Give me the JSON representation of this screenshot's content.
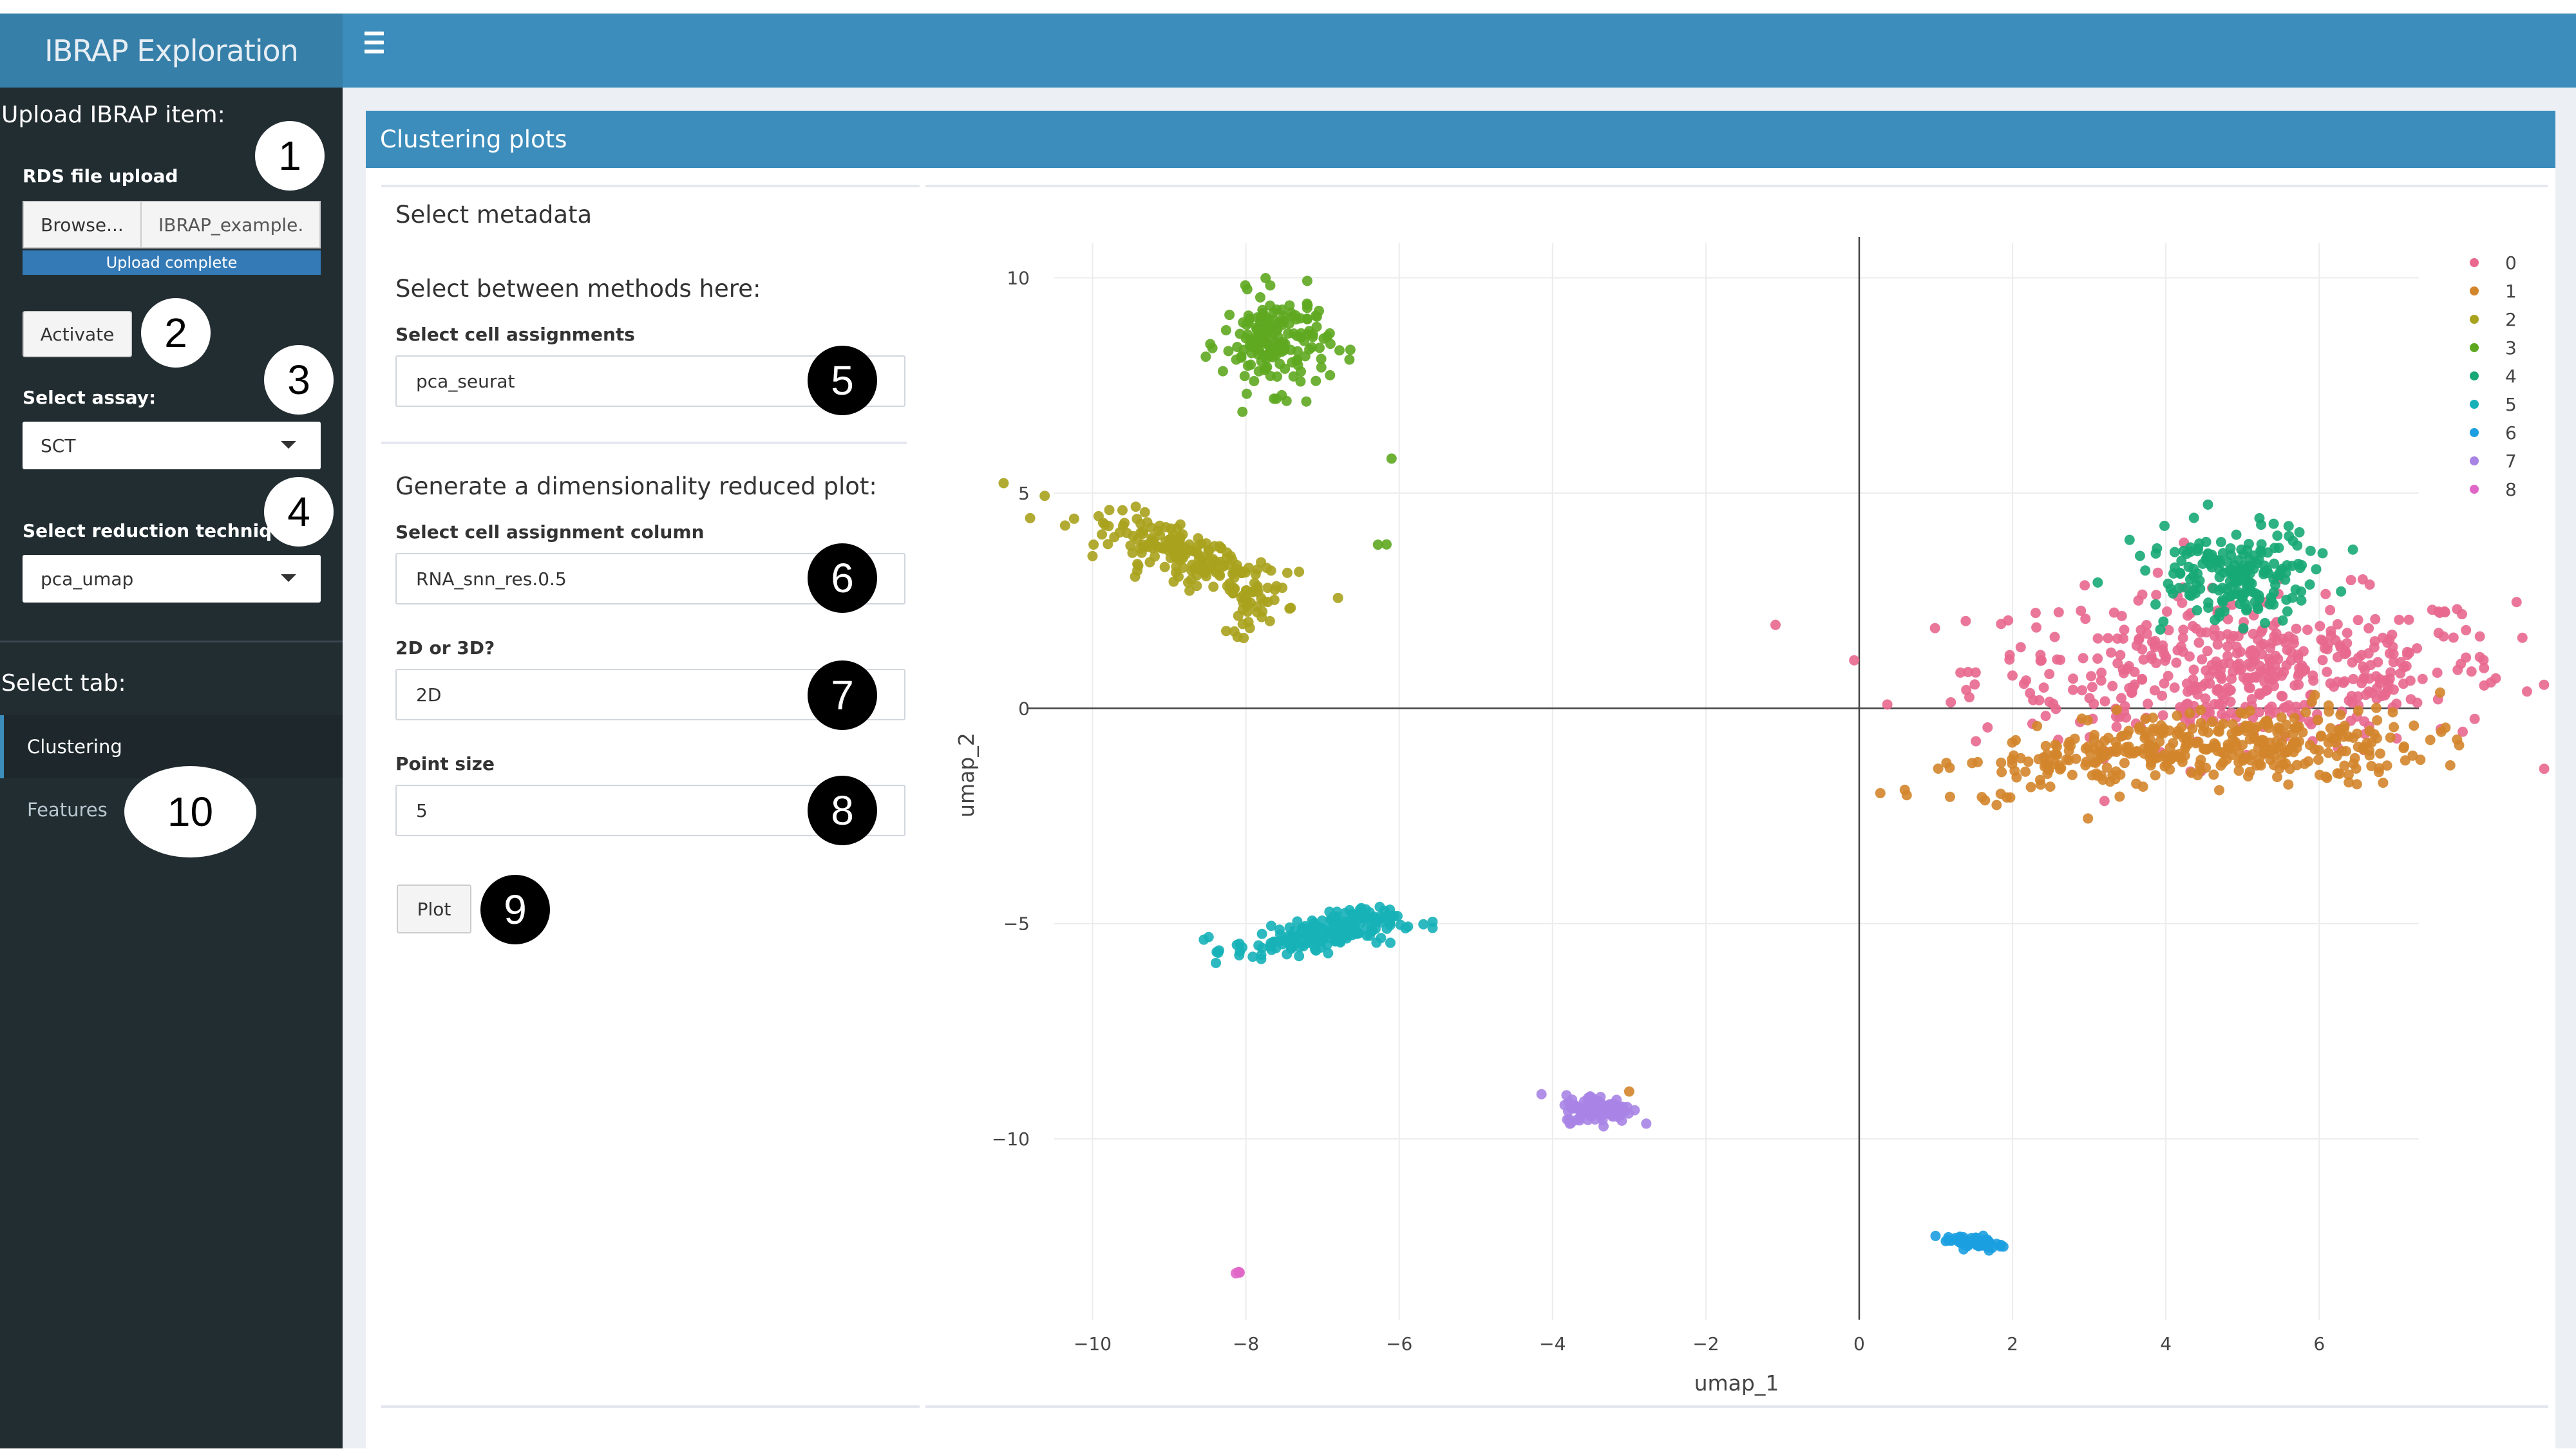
{
  "app": {
    "title": "IBRAP Exploration"
  },
  "sidebar": {
    "upload_title": "Upload IBRAP item:",
    "rds_label": "RDS file upload",
    "browse_label": "Browse...",
    "file_name": "IBRAP_example.",
    "upload_status": "Upload complete",
    "activate_label": "Activate",
    "assay_label": "Select assay:",
    "assay_value": "SCT",
    "reduction_label": "Select reduction technique",
    "reduction_value": "pca_umap",
    "tab_title": "Select tab:",
    "tabs": [
      {
        "label": "Clustering",
        "active": true
      },
      {
        "label": "Features",
        "active": false
      }
    ]
  },
  "main": {
    "box_title": "Clustering plots",
    "section_title": "Select metadata",
    "methods_heading": "Select between methods here:",
    "cell_assign_label": "Select cell assignments",
    "cell_assign_value": "pca_seurat",
    "dimred_heading": "Generate a dimensionality reduced plot:",
    "column_label": "Select cell assignment column",
    "column_value": "RNA_snn_res.0.5",
    "dim_label": "2D or 3D?",
    "dim_value": "2D",
    "point_size_label": "Point size",
    "point_size_value": "5",
    "plot_label": "Plot"
  },
  "callouts": [
    "1",
    "2",
    "3",
    "4",
    "5",
    "6",
    "7",
    "8",
    "9",
    "10"
  ],
  "colors": {
    "header": "#3c8dbc",
    "logo": "#367fa9",
    "sidebar": "#222d32",
    "sidebar_active": "#1e282c",
    "content_bg": "#ecf0f5"
  },
  "chart_data": {
    "type": "scatter",
    "xlabel": "umap_1",
    "ylabel": "umap_2",
    "xlim": [
      -10.5,
      7.3
    ],
    "ylim": [
      -14.2,
      10.8
    ],
    "xticks": [
      -10,
      -8,
      -6,
      -4,
      -2,
      0,
      2,
      4,
      6
    ],
    "yticks": [
      10,
      5,
      0,
      -5,
      -10
    ],
    "grid": true,
    "legend_position": "top-right",
    "legend": [
      "0",
      "1",
      "2",
      "3",
      "4",
      "5",
      "6",
      "7",
      "8"
    ],
    "series_colors": [
      "#e8688e",
      "#d3852b",
      "#a9a21d",
      "#5ea820",
      "#17a876",
      "#16b1b8",
      "#1b9fe0",
      "#a884e5",
      "#e066c7"
    ],
    "series": [
      {
        "name": "0",
        "clusters": [
          {
            "cx": 5.0,
            "cy": 0.9,
            "sx": 1.75,
            "sy": 0.9,
            "n": 420
          },
          {
            "cx": 5.5,
            "cy": 0.6,
            "sx": 1.1,
            "sy": 0.5,
            "n": 80
          }
        ]
      },
      {
        "name": "1",
        "clusters": [
          {
            "cx": 3.4,
            "cy": -1.1,
            "sx": 1.4,
            "sy": 0.32,
            "n": 170,
            "tilt": 0.28
          },
          {
            "cx": 5.2,
            "cy": -0.9,
            "sx": 1.1,
            "sy": 0.45,
            "n": 220
          },
          {
            "cx": -3.0,
            "cy": -8.9,
            "sx": 0.03,
            "sy": 0.03,
            "n": 1
          }
        ]
      },
      {
        "name": "2",
        "clusters": [
          {
            "cx": -8.7,
            "cy": 3.5,
            "sx": 0.8,
            "sy": 0.25,
            "n": 190,
            "tilt": -0.6
          },
          {
            "cx": -8.0,
            "cy": 2.4,
            "sx": 0.12,
            "sy": 0.35,
            "n": 30
          }
        ]
      },
      {
        "name": "3",
        "clusters": [
          {
            "cx": -7.6,
            "cy": 8.5,
            "sx": 0.35,
            "sy": 0.55,
            "n": 170
          },
          {
            "cx": -6.1,
            "cy": 5.8,
            "sx": 0.02,
            "sy": 0.02,
            "n": 1
          },
          {
            "cx": -6.2,
            "cy": 3.8,
            "sx": 0.03,
            "sy": 0.03,
            "n": 2
          }
        ]
      },
      {
        "name": "4",
        "clusters": [
          {
            "cx": 4.9,
            "cy": 3.1,
            "sx": 0.55,
            "sy": 0.55,
            "n": 190,
            "tilt": 0.5
          }
        ]
      },
      {
        "name": "5",
        "clusters": [
          {
            "cx": -7.1,
            "cy": -5.3,
            "sx": 0.55,
            "sy": 0.18,
            "n": 160,
            "tilt": 0.25
          },
          {
            "cx": -6.5,
            "cy": -4.8,
            "sx": 0.25,
            "sy": 0.1,
            "n": 30
          }
        ]
      },
      {
        "name": "6",
        "clusters": [
          {
            "cx": 1.5,
            "cy": -12.4,
            "sx": 0.2,
            "sy": 0.08,
            "n": 60,
            "tilt": -0.2
          }
        ]
      },
      {
        "name": "7",
        "clusters": [
          {
            "cx": -3.4,
            "cy": -9.3,
            "sx": 0.22,
            "sy": 0.16,
            "n": 110
          }
        ]
      },
      {
        "name": "8",
        "clusters": [
          {
            "cx": -8.1,
            "cy": -13.1,
            "sx": 0.04,
            "sy": 0.04,
            "n": 3
          }
        ]
      }
    ]
  }
}
